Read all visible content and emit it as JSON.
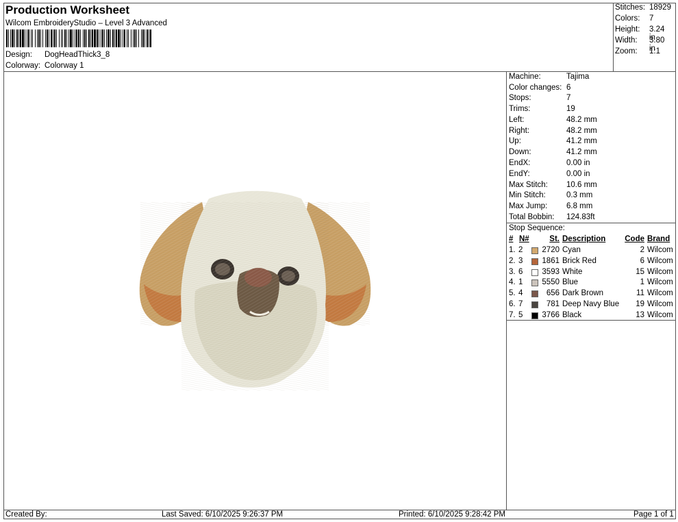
{
  "header": {
    "title": "Production Worksheet",
    "subtitle": "Wilcom EmbroideryStudio – Level 3 Advanced",
    "design_label": "Design:",
    "design_value": "DogHeadThick3_8",
    "colorway_label": "Colorway:",
    "colorway_value": "Colorway 1"
  },
  "summary": [
    {
      "label": "Stitches:",
      "value": "18929"
    },
    {
      "label": "Colors:",
      "value": "7"
    },
    {
      "label": "Height:",
      "value": "3.24 in"
    },
    {
      "label": "Width:",
      "value": "3.80 in"
    },
    {
      "label": "Zoom:",
      "value": "1:1"
    }
  ],
  "stats": [
    {
      "label": "Machine:",
      "value": "Tajima"
    },
    {
      "label": "Color changes:",
      "value": "6"
    },
    {
      "label": "Stops:",
      "value": "7"
    },
    {
      "label": "Trims:",
      "value": "19"
    },
    {
      "label": "Left:",
      "value": "48.2 mm"
    },
    {
      "label": "Right:",
      "value": "48.2 mm"
    },
    {
      "label": "Up:",
      "value": "41.2 mm"
    },
    {
      "label": "Down:",
      "value": "41.2 mm"
    },
    {
      "label": "EndX:",
      "value": "0.00 in"
    },
    {
      "label": "EndY:",
      "value": "0.00 in"
    },
    {
      "label": "Max Stitch:",
      "value": "10.6 mm"
    },
    {
      "label": "Min Stitch:",
      "value": "0.3 mm"
    },
    {
      "label": "Max Jump:",
      "value": "6.8 mm"
    },
    {
      "label": "Total Bobbin:",
      "value": "124.83ft"
    }
  ],
  "stop_sequence": {
    "title": "Stop Sequence:",
    "headers": {
      "num": "#",
      "n": "N#",
      "st": "St.",
      "desc": "Description",
      "code": "Code",
      "brand": "Brand"
    },
    "rows": [
      {
        "num": "1.",
        "n": "2",
        "color": "#d2a86e",
        "st": "2720",
        "desc": "Cyan",
        "code": "2",
        "brand": "Wilcom"
      },
      {
        "num": "2.",
        "n": "3",
        "color": "#b5653a",
        "st": "1861",
        "desc": "Brick Red",
        "code": "6",
        "brand": "Wilcom"
      },
      {
        "num": "3.",
        "n": "6",
        "color": "#ffffff",
        "st": "3593",
        "desc": "White",
        "code": "15",
        "brand": "Wilcom"
      },
      {
        "num": "4.",
        "n": "1",
        "color": "#cbc3bb",
        "st": "5550",
        "desc": "Blue",
        "code": "1",
        "brand": "Wilcom"
      },
      {
        "num": "5.",
        "n": "4",
        "color": "#7a574a",
        "st": "656",
        "desc": "Dark Brown",
        "code": "11",
        "brand": "Wilcom"
      },
      {
        "num": "6.",
        "n": "7",
        "color": "#4a4540",
        "st": "781",
        "desc": "Deep Navy Blue",
        "code": "19",
        "brand": "Wilcom"
      },
      {
        "num": "7.",
        "n": "5",
        "color": "#000000",
        "st": "3766",
        "desc": "Black",
        "code": "13",
        "brand": "Wilcom"
      }
    ]
  },
  "footer": {
    "created_by": "Created By:",
    "last_saved": "Last Saved: 6/10/2025 9:26:37 PM",
    "printed": "Printed: 6/10/2025 9:28:42 PM",
    "page": "Page 1 of 1"
  }
}
